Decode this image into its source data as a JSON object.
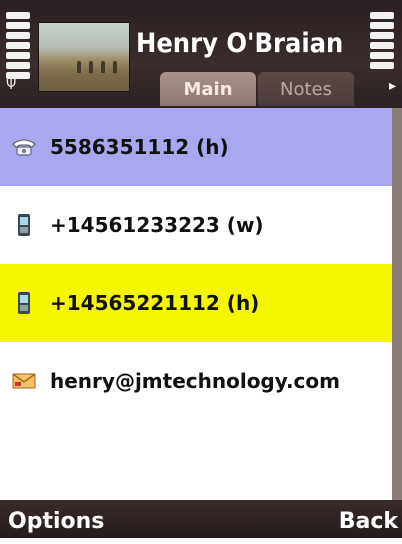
{
  "contact": {
    "name": "Henry O'Braian"
  },
  "tabs": [
    {
      "label": "Main",
      "active": true
    },
    {
      "label": "Notes",
      "active": false
    }
  ],
  "entries": [
    {
      "icon": "landline-phone-icon",
      "label": "5586351112 (h)",
      "state": "selected"
    },
    {
      "icon": "mobile-phone-icon",
      "label": "+14561233223 (w)",
      "state": "normal"
    },
    {
      "icon": "mobile-phone-icon",
      "label": "+14565221112 (h)",
      "state": "highlighted"
    },
    {
      "icon": "envelope-icon",
      "label": "henry@jmtechnology.com",
      "state": "normal"
    }
  ],
  "softkeys": {
    "left": "Options",
    "right": "Back"
  },
  "colors": {
    "selected_row": "#a9a7f0",
    "highlight_row": "#f6f600",
    "header_bg": "#2a1f22"
  }
}
